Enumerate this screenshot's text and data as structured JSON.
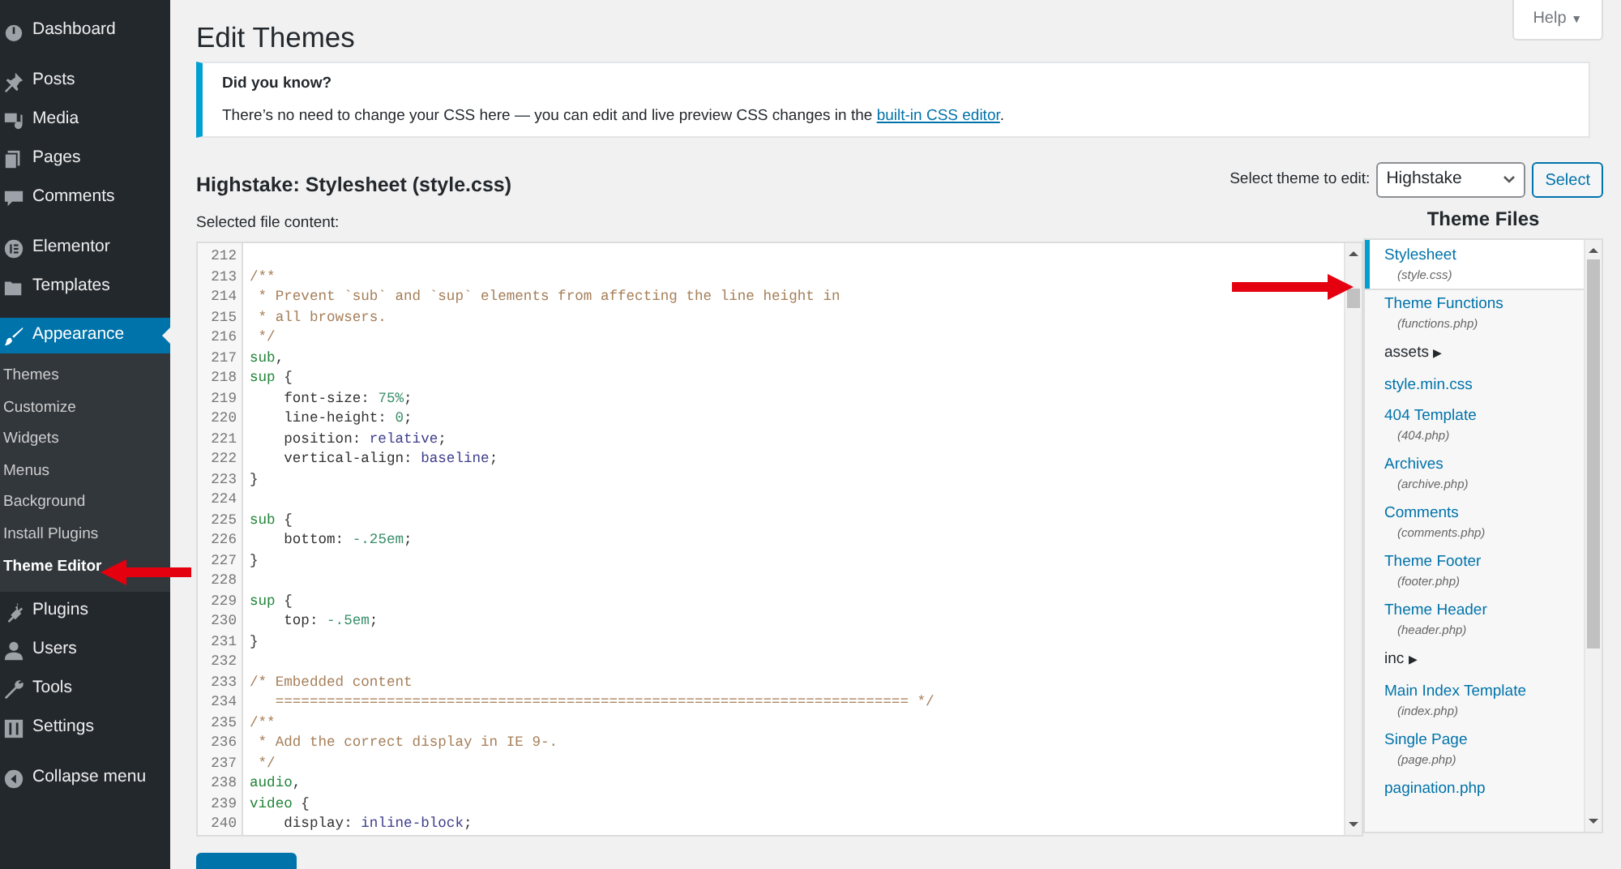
{
  "sidebar": {
    "groups": [
      [
        {
          "label": "Dashboard",
          "selected": false
        }
      ],
      [
        {
          "label": "Posts",
          "selected": false
        },
        {
          "label": "Media",
          "selected": false
        },
        {
          "label": "Pages",
          "selected": false
        },
        {
          "label": "Comments",
          "selected": false
        }
      ],
      [
        {
          "label": "Elementor",
          "selected": false
        },
        {
          "label": "Templates",
          "selected": false
        }
      ],
      [
        {
          "label": "Appearance",
          "selected": true,
          "submenu": [
            {
              "label": "Themes",
              "selected": false
            },
            {
              "label": "Customize",
              "selected": false
            },
            {
              "label": "Widgets",
              "selected": false
            },
            {
              "label": "Menus",
              "selected": false
            },
            {
              "label": "Background",
              "selected": false
            },
            {
              "label": "Install Plugins",
              "selected": false
            },
            {
              "label": "Theme Editor",
              "selected": true
            }
          ]
        },
        {
          "label": "Plugins",
          "selected": false
        },
        {
          "label": "Users",
          "selected": false
        },
        {
          "label": "Tools",
          "selected": false
        },
        {
          "label": "Settings",
          "selected": false
        }
      ],
      [
        {
          "label": "Collapse menu",
          "selected": false
        }
      ]
    ]
  },
  "help": {
    "label": "Help",
    "caret": "▼"
  },
  "title": "Edit Themes",
  "notice": {
    "heading": "Did you know?",
    "text": "There’s no need to change your CSS here — you can edit and live preview CSS changes in the ",
    "link": "built-in CSS editor",
    "text_end": "."
  },
  "file_heading": "Highstake: Stylesheet (style.css)",
  "theme_select": {
    "label": "Select theme to edit:",
    "value": "Highstake",
    "button": "Select"
  },
  "content_label": "Selected file content:",
  "code_lines": [
    {
      "line_number": "212"
    },
    {
      "line_number": "213",
      "parts": [
        {
          "kind": "comment",
          "text": "/**"
        }
      ]
    },
    {
      "line_number": "214",
      "parts": [
        {
          "kind": "comment",
          "text": " * Prevent `sub` and `sup` elements from affecting the line height in"
        }
      ]
    },
    {
      "line_number": "215",
      "parts": [
        {
          "kind": "comment",
          "text": " * all browsers."
        }
      ]
    },
    {
      "line_number": "216",
      "parts": [
        {
          "kind": "comment",
          "text": " */"
        }
      ]
    },
    {
      "line_number": "217",
      "parts": [
        {
          "kind": "selector",
          "text": "sub"
        },
        {
          "kind": "plain",
          "text": ","
        }
      ]
    },
    {
      "line_number": "218",
      "parts": [
        {
          "kind": "selector",
          "text": "sup"
        },
        {
          "kind": "plain",
          "text": " {"
        }
      ]
    },
    {
      "line_number": "219",
      "parts": [
        {
          "kind": "plain",
          "text": "    font-size: "
        },
        {
          "kind": "number",
          "text": "75%"
        },
        {
          "kind": "plain",
          "text": ";"
        }
      ]
    },
    {
      "line_number": "220",
      "parts": [
        {
          "kind": "plain",
          "text": "    line-height: "
        },
        {
          "kind": "number",
          "text": "0"
        },
        {
          "kind": "plain",
          "text": ";"
        }
      ]
    },
    {
      "line_number": "221",
      "parts": [
        {
          "kind": "plain",
          "text": "    position: "
        },
        {
          "kind": "keyword",
          "text": "relative"
        },
        {
          "kind": "plain",
          "text": ";"
        }
      ]
    },
    {
      "line_number": "222",
      "parts": [
        {
          "kind": "plain",
          "text": "    vertical-align: "
        },
        {
          "kind": "keyword",
          "text": "baseline"
        },
        {
          "kind": "plain",
          "text": ";"
        }
      ]
    },
    {
      "line_number": "223",
      "parts": [
        {
          "kind": "plain",
          "text": "}"
        }
      ]
    },
    {
      "line_number": "224"
    },
    {
      "line_number": "225",
      "parts": [
        {
          "kind": "selector",
          "text": "sub"
        },
        {
          "kind": "plain",
          "text": " {"
        }
      ]
    },
    {
      "line_number": "226",
      "parts": [
        {
          "kind": "plain",
          "text": "    bottom: "
        },
        {
          "kind": "number",
          "text": "-.25em"
        },
        {
          "kind": "plain",
          "text": ";"
        }
      ]
    },
    {
      "line_number": "227",
      "parts": [
        {
          "kind": "plain",
          "text": "}"
        }
      ]
    },
    {
      "line_number": "228"
    },
    {
      "line_number": "229",
      "parts": [
        {
          "kind": "selector",
          "text": "sup"
        },
        {
          "kind": "plain",
          "text": " {"
        }
      ]
    },
    {
      "line_number": "230",
      "parts": [
        {
          "kind": "plain",
          "text": "    top: "
        },
        {
          "kind": "number",
          "text": "-.5em"
        },
        {
          "kind": "plain",
          "text": ";"
        }
      ]
    },
    {
      "line_number": "231",
      "parts": [
        {
          "kind": "plain",
          "text": "}"
        }
      ]
    },
    {
      "line_number": "232"
    },
    {
      "line_number": "233",
      "parts": [
        {
          "kind": "comment",
          "text": "/* Embedded content"
        }
      ]
    },
    {
      "line_number": "234",
      "parts": [
        {
          "kind": "comment",
          "text": "   ========================================================================== */"
        }
      ]
    },
    {
      "line_number": "235",
      "parts": [
        {
          "kind": "comment",
          "text": "/**"
        }
      ]
    },
    {
      "line_number": "236",
      "parts": [
        {
          "kind": "comment",
          "text": " * Add the correct display in IE 9-."
        }
      ]
    },
    {
      "line_number": "237",
      "parts": [
        {
          "kind": "comment",
          "text": " */"
        }
      ]
    },
    {
      "line_number": "238",
      "parts": [
        {
          "kind": "selector",
          "text": "audio"
        },
        {
          "kind": "plain",
          "text": ","
        }
      ]
    },
    {
      "line_number": "239",
      "parts": [
        {
          "kind": "selector",
          "text": "video"
        },
        {
          "kind": "plain",
          "text": " {"
        }
      ]
    },
    {
      "line_number": "240",
      "parts": [
        {
          "kind": "plain",
          "text": "    display: "
        },
        {
          "kind": "keyword",
          "text": "inline-block"
        },
        {
          "kind": "plain",
          "text": ";"
        }
      ]
    }
  ],
  "files_heading": "Theme Files",
  "files": [
    {
      "kind": "file",
      "name": "Stylesheet",
      "filename": "(style.css)",
      "selected": true
    },
    {
      "kind": "file",
      "name": "Theme Functions",
      "filename": "(functions.php)",
      "selected": false
    },
    {
      "kind": "folder",
      "name": "assets",
      "arrow": "▶",
      "selected": false
    },
    {
      "kind": "file",
      "name": "style.min.css",
      "selected": false
    },
    {
      "kind": "file",
      "name": "404 Template",
      "filename": "(404.php)",
      "selected": false
    },
    {
      "kind": "file",
      "name": "Archives",
      "filename": "(archive.php)",
      "selected": false
    },
    {
      "kind": "file",
      "name": "Comments",
      "filename": "(comments.php)",
      "selected": false
    },
    {
      "kind": "file",
      "name": "Theme Footer",
      "filename": "(footer.php)",
      "selected": false
    },
    {
      "kind": "file",
      "name": "Theme Header",
      "filename": "(header.php)",
      "selected": false
    },
    {
      "kind": "folder",
      "name": "inc",
      "arrow": "▶",
      "selected": false
    },
    {
      "kind": "file",
      "name": "Main Index Template",
      "filename": "(index.php)",
      "selected": false
    },
    {
      "kind": "file",
      "name": "Single Page",
      "filename": "(page.php)",
      "selected": false
    },
    {
      "kind": "file",
      "name": "pagination.php",
      "selected": false
    }
  ]
}
